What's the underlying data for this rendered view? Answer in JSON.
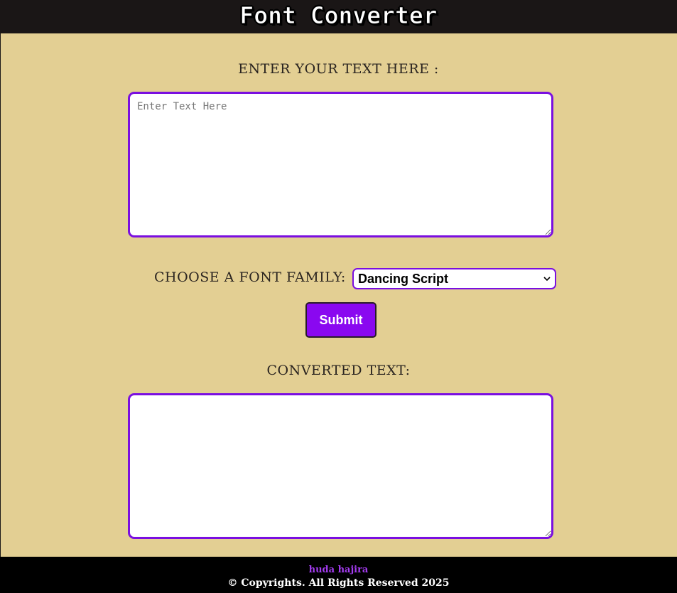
{
  "header": {
    "title": "Font Converter"
  },
  "input": {
    "label": "Enter your text here :",
    "placeholder": "Enter Text Here",
    "value": ""
  },
  "font_select": {
    "label": "Choose a font family:",
    "selected": "Dancing Script"
  },
  "submit": {
    "label": "Submit"
  },
  "output": {
    "label": "Converted Text:",
    "value": ""
  },
  "footer": {
    "author": "huda hajira",
    "copyright": "© Copyrights. All Rights Reserved 2025"
  },
  "colors": {
    "background": "#e3cf93",
    "header": "#1a1616",
    "accent": "#7a0fe0",
    "button": "#8a08f0",
    "footer": "#000000",
    "author": "#a43cf0"
  }
}
